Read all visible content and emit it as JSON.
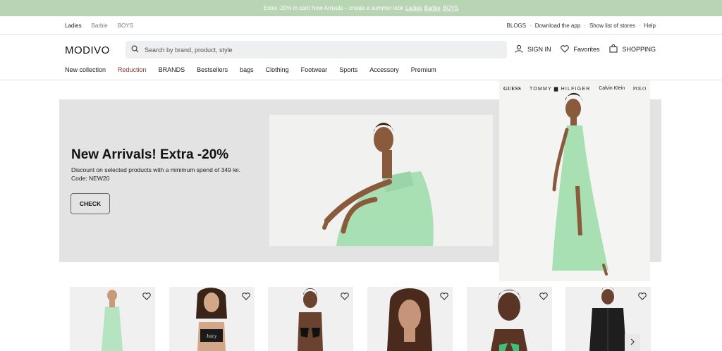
{
  "promo": {
    "text": "Extra -20% in cart! New Arrivals – create a summer look",
    "links": [
      "Ladies",
      "Barbie",
      "BOYS"
    ]
  },
  "gender_tabs": [
    {
      "label": "Ladies",
      "active": true
    },
    {
      "label": "Barbie",
      "active": false
    },
    {
      "label": "BOYS",
      "active": false
    }
  ],
  "utility_links": [
    "BLOGS",
    "Download the app",
    "Show list of stores",
    "Help"
  ],
  "header": {
    "logo": "MODIVO",
    "search_placeholder": "Search by brand, product, style",
    "sign_in": "SIGN IN",
    "favorites": "Favorites",
    "shopping": "SHOPPING"
  },
  "categories": [
    {
      "label": "New collection"
    },
    {
      "label": "Reduction",
      "highlight": true
    },
    {
      "label": "BRANDS"
    },
    {
      "label": "Bestsellers"
    },
    {
      "label": "bags"
    },
    {
      "label": "Clothing"
    },
    {
      "label": "Footwear"
    },
    {
      "label": "Sports"
    },
    {
      "label": "Accessory"
    },
    {
      "label": "Premium"
    }
  ],
  "hero": {
    "title": "New Arrivals! Extra -20%",
    "description": "Discount on selected products with a minimum spend of 349 lei. Code: NEW20",
    "cta": "CHECK"
  },
  "brand_panel": {
    "brands": [
      "GUESS",
      "TOMMY ▆ HILFIGER",
      "Calvin Klein",
      "POLO"
    ]
  },
  "colors": {
    "promo_bg": "#b8d5b3",
    "hero_bg": "#e3e3e3",
    "dress_green": "#a8e0b4",
    "reduction_red": "#8b3a2a"
  },
  "products_icons": [
    "heart-icon",
    "heart-icon",
    "heart-icon",
    "heart-icon",
    "heart-icon",
    "heart-icon"
  ]
}
